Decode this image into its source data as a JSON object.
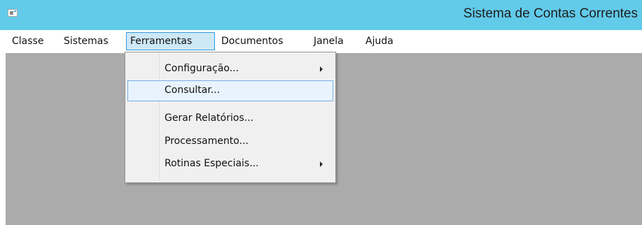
{
  "window": {
    "title": "Sistema de Contas Correntes",
    "icon": "app-window-icon"
  },
  "menubar": {
    "items": [
      {
        "label": "Classe"
      },
      {
        "label": "Sistemas"
      },
      {
        "label": "Ferramentas",
        "active": true
      },
      {
        "label": "Documentos"
      },
      {
        "label": "Janela"
      },
      {
        "label": "Ajuda"
      }
    ]
  },
  "dropdown": {
    "items": [
      {
        "label": "Configuração...",
        "submenu": true
      },
      {
        "label": "Consultar...",
        "highlighted": true
      },
      {
        "label": "Gerar Relatórios..."
      },
      {
        "label": "Processamento..."
      },
      {
        "label": "Rotinas Especiais...",
        "submenu": true
      }
    ]
  },
  "colors": {
    "titlebar": "#62cbea",
    "workspace": "#ababab",
    "menu_highlight_bg": "#cde8f7",
    "menu_highlight_border": "#3399dd",
    "dropdown_bg": "#f0f0f0"
  }
}
